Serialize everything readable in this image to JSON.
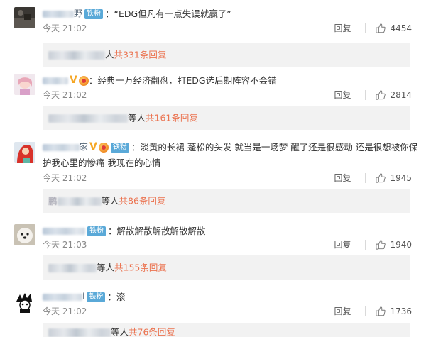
{
  "comments": [
    {
      "name_tail": "野",
      "fan_badge": "铁粉",
      "colon": "：",
      "text": "“EDG但凡有一点失误就赢了”",
      "time": "今天 21:02",
      "reply": "回复",
      "likes": "4454",
      "sub_mid": "人",
      "sub_link": "共331条回复",
      "avatar": "dark-landscape"
    },
    {
      "name_tail": "",
      "colon": "：",
      "text": "经典一万经济翻盘，打EDG选后期阵容不会错",
      "time": "今天 21:02",
      "reply": "回复",
      "likes": "2814",
      "sub_mid": "等人",
      "sub_link": "共161条回复",
      "avatar": "pink-girl"
    },
    {
      "name_tail": "家",
      "fan_badge": "铁粉",
      "colon": "：",
      "text": "淡黄的长裙 蓬松的头发 就当是一场梦 醒了还是很感动 还是很想被你保护我心里的惨痛 我现在的心情",
      "time": "今天 21:02",
      "reply": "回复",
      "likes": "1945",
      "sub_prefix": "鹏",
      "sub_mid": "等人",
      "sub_link": "共86条回复",
      "avatar": "red-hair"
    },
    {
      "name_tail": "",
      "fan_badge": "铁粉",
      "colon": "：",
      "text": "解散解散解散解散解散",
      "time": "今天 21:03",
      "reply": "回复",
      "likes": "1940",
      "sub_mid": "等人",
      "sub_link": "共155条回复",
      "avatar": "white-dog"
    },
    {
      "name_tail": "i",
      "fan_badge": "铁粉",
      "colon": "：",
      "text": "滚",
      "time": "今天 21:02",
      "reply": "回复",
      "likes": "1736",
      "sub_mid": "等人",
      "sub_link": "共76条回复",
      "avatar": "black-white-anime"
    }
  ],
  "colors": {
    "link": "#eb7350",
    "fan_badge": "#5aa9d8",
    "vip": "#f5a623",
    "subbox_bg": "#f2f2f2"
  }
}
